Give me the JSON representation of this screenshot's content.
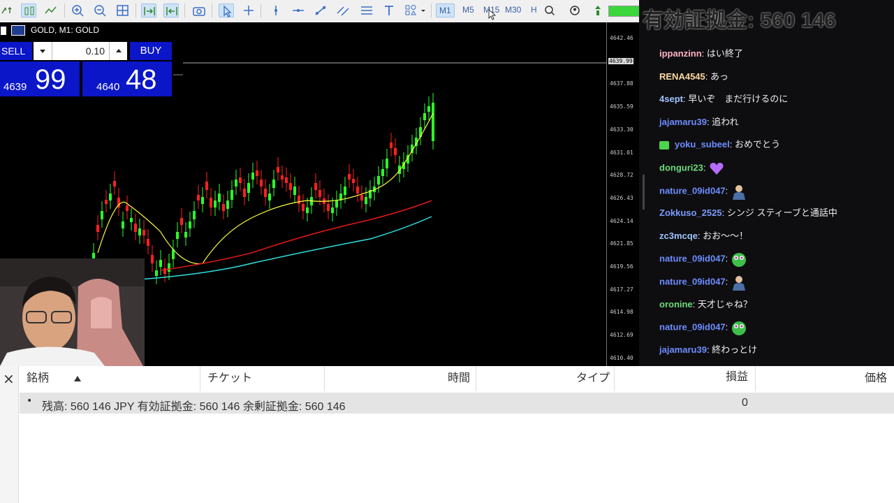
{
  "toolbar": {
    "timeframes": [
      "M1",
      "M5",
      "M15",
      "M30",
      "H"
    ],
    "active_timeframe": "M1"
  },
  "overlay": {
    "equity_text": "有効証拠金: 560 146"
  },
  "chart": {
    "title": "GOLD, M1:  GOLD",
    "price_ticks": [
      "4642.46",
      "4639.99",
      "4637.88",
      "4635.59",
      "4633.30",
      "4631.01",
      "4628.72",
      "4626.43",
      "4624.14",
      "4621.85",
      "4619.56",
      "4617.27",
      "4614.98",
      "4612.69",
      "4610.40"
    ],
    "current_price_label": "4639.99"
  },
  "one_click": {
    "sell_label": "SELL",
    "buy_label": "BUY",
    "lot": "0.10",
    "sell_prefix": "4639",
    "sell_big": "99",
    "buy_prefix": "4640",
    "buy_big": "48"
  },
  "chat": {
    "messages": [
      {
        "user": "ippanzinn",
        "text": "はい終了",
        "color": "#ffb3c6"
      },
      {
        "user": "RENA4545",
        "text": "あっ",
        "color": "#ffd9a0"
      },
      {
        "user": "4sept",
        "text": "早いぞ　まだ行けるのに",
        "color": "#9ec5ff"
      },
      {
        "user": "jajamaru39",
        "text": "追われ",
        "color": "#6d8cff"
      },
      {
        "user": "yoku_subeel",
        "text": "おめでとう",
        "color": "#6d8cff",
        "badge": true
      },
      {
        "user": "donguri23",
        "text": "",
        "color": "#6ddc7a",
        "emote": "heart"
      },
      {
        "user": "nature_09id047",
        "text": "",
        "color": "#6d8cff",
        "emote": "man"
      },
      {
        "user": "Zokkuso_2525",
        "text": "シンジ スティーブと通話中",
        "color": "#7c9cff"
      },
      {
        "user": "zc3mcqe",
        "text": "おお〜～！",
        "color": "#9ec5ff"
      },
      {
        "user": "nature_09id047",
        "text": "",
        "color": "#6d8cff",
        "emote": "frog"
      },
      {
        "user": "nature_09id047",
        "text": "",
        "color": "#6d8cff",
        "emote": "man"
      },
      {
        "user": "oronine",
        "text": "天才じゃね？",
        "color": "#6ddc7a"
      },
      {
        "user": "nature_09id047",
        "text": "",
        "color": "#6d8cff",
        "emote": "frog"
      },
      {
        "user": "jajamaru39",
        "text": "終わっとけ",
        "color": "#6d8cff"
      }
    ]
  },
  "terminal": {
    "close_label": "×",
    "columns": [
      "銘柄",
      "チケット",
      "時間",
      "タイプ",
      "損益",
      "価格"
    ],
    "balance_text": "残高: 560 146 JPY  有効証拠金: 560 146  余剰証拠金: 560 146",
    "profit_value": "0"
  }
}
